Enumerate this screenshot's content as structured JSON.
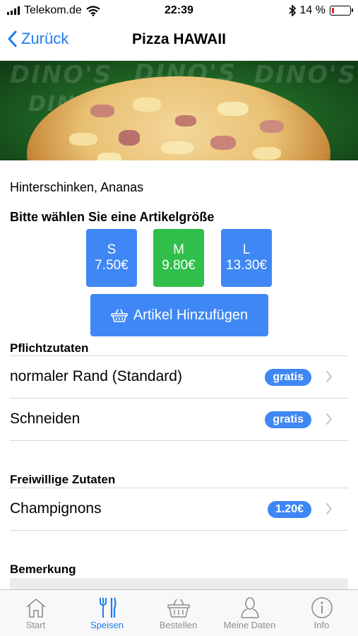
{
  "status_bar": {
    "carrier": "Telekom.de",
    "time": "22:39",
    "battery_percent": "14 %",
    "battery_level": 0.14,
    "icons": [
      "signal-icon",
      "wifi-icon",
      "bluetooth-icon",
      "battery-icon"
    ]
  },
  "nav": {
    "back_label": "Zurück",
    "title": "Pizza HAWAII"
  },
  "hero": {
    "watermark": [
      "DINO'S",
      "DINO'S",
      "DINO'S"
    ]
  },
  "description": "Hinterschinken, Ananas",
  "size_heading": "Bitte wählen Sie eine Artikelgröße",
  "sizes": [
    {
      "label": "S",
      "price": "7.50€",
      "color": "#3f87f5",
      "selected": false
    },
    {
      "label": "M",
      "price": "9.80€",
      "color": "#2fbf4a",
      "selected": true
    },
    {
      "label": "L",
      "price": "13.30€",
      "color": "#3f87f5",
      "selected": false
    }
  ],
  "add_button": {
    "label": "Artikel Hinzufügen",
    "icon": "basket-icon"
  },
  "pflicht": {
    "heading": "Pflichtzutaten",
    "rows": [
      {
        "label": "normaler Rand (Standard)",
        "badge": "gratis"
      },
      {
        "label": "Schneiden",
        "badge": "gratis"
      }
    ]
  },
  "freiwillig": {
    "heading": "Freiwillige Zutaten",
    "rows": [
      {
        "label": "Champignons",
        "badge": "1.20€"
      }
    ]
  },
  "remark_heading": "Bemerkung",
  "accent_color": "#1e7cf0",
  "tabs": [
    {
      "label": "Start",
      "icon": "home-icon",
      "active": false
    },
    {
      "label": "Speisen",
      "icon": "cutlery-icon",
      "active": true
    },
    {
      "label": "Bestellen",
      "icon": "basket-icon",
      "active": false
    },
    {
      "label": "Meine Daten",
      "icon": "user-icon",
      "active": false
    },
    {
      "label": "Info",
      "icon": "info-icon",
      "active": false
    }
  ]
}
